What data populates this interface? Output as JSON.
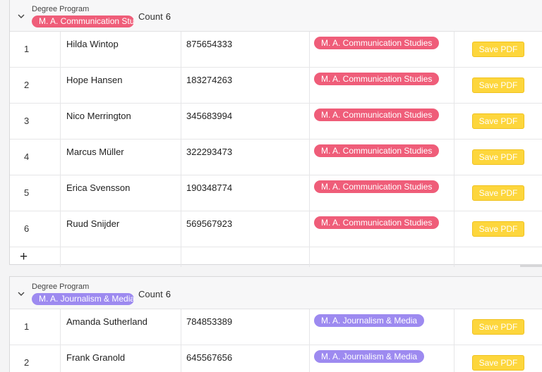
{
  "groups": [
    {
      "header": {
        "label": "Degree Program",
        "chip": "M. A. Communication Studies",
        "count_label": "Count",
        "count": "6",
        "chip_color": "#ef5d79"
      },
      "rows": [
        {
          "num": "1",
          "name": "Hilda Wintop",
          "id": "875654333",
          "program": "M. A. Communication Studies",
          "button": "Save PDF"
        },
        {
          "num": "2",
          "name": "Hope Hansen",
          "id": "183274263",
          "program": "M. A. Communication Studies",
          "button": "Save PDF"
        },
        {
          "num": "3",
          "name": "Nico Merrington",
          "id": "345683994",
          "program": "M. A. Communication Studies",
          "button": "Save PDF"
        },
        {
          "num": "4",
          "name": "Marcus Müller",
          "id": "322293473",
          "program": "M. A. Communication Studies",
          "button": "Save PDF"
        },
        {
          "num": "5",
          "name": "Erica Svensson",
          "id": "190348774",
          "program": "M. A. Communication Studies",
          "button": "Save PDF"
        },
        {
          "num": "6",
          "name": "Ruud Snijder",
          "id": "569567923",
          "program": "M. A. Communication Studies",
          "button": "Save PDF"
        }
      ],
      "add": "+"
    },
    {
      "header": {
        "label": "Degree Program",
        "chip": "M. A. Journalism & Media",
        "count_label": "Count",
        "count": "6",
        "chip_color": "#9d8af0"
      },
      "rows": [
        {
          "num": "1",
          "name": "Amanda Sutherland",
          "id": "784853389",
          "program": "M. A. Journalism & Media",
          "button": "Save PDF"
        },
        {
          "num": "2",
          "name": "Frank Granold",
          "id": "645567656",
          "program": "M. A. Journalism & Media",
          "button": "Save PDF"
        }
      ]
    }
  ],
  "icons": {
    "collapse": "chevron-down-icon",
    "add": "plus-icon"
  },
  "colors": {
    "button": "#fdd63c",
    "communication": "#ef5d79",
    "journalism": "#9d8af0"
  }
}
